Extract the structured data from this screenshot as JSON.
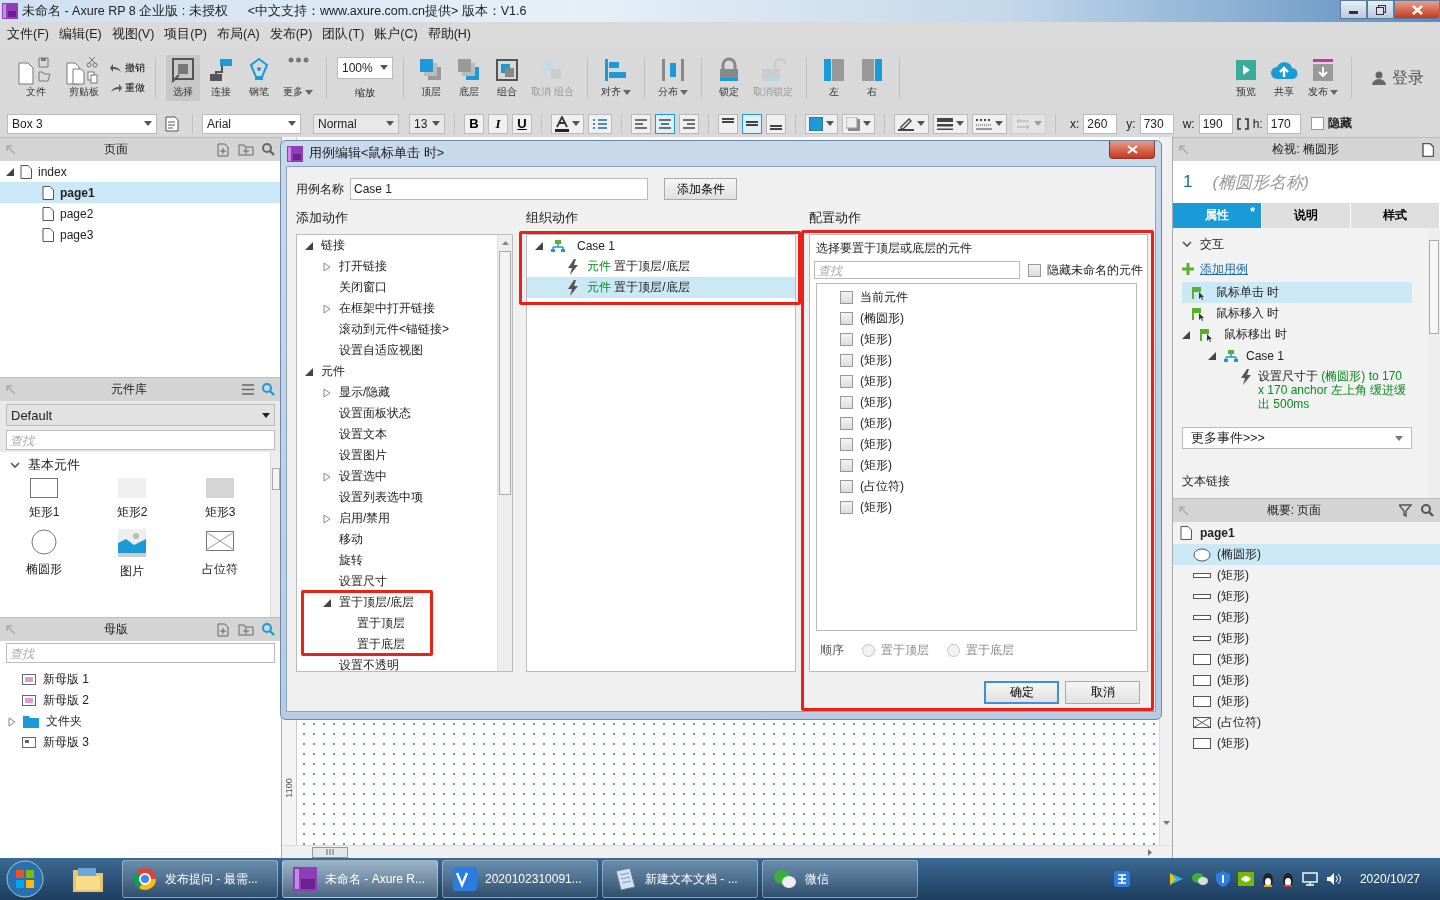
{
  "window": {
    "title": "未命名 - Axure RP 8 企业版 : 未授权",
    "subtitle": "<中文支持：www.axure.com.cn提供> 版本：V1.6"
  },
  "menu": [
    "文件(F)",
    "编辑(E)",
    "视图(V)",
    "项目(P)",
    "布局(A)",
    "发布(P)",
    "团队(T)",
    "账户(C)",
    "帮助(H)"
  ],
  "toolbar": {
    "groups": [
      [
        {
          "kind": "button",
          "label": "文件"
        },
        {
          "kind": "button",
          "label": "剪贴板"
        },
        {
          "kind": "history",
          "entries": [
            {
              "label": "撤销"
            },
            {
              "label": "重做"
            }
          ]
        }
      ],
      [
        {
          "kind": "button",
          "label": "选择",
          "selected": true
        },
        {
          "kind": "button",
          "label": "连接",
          "selected": false
        },
        {
          "kind": "button",
          "label": "钢笔",
          "selected": false
        },
        {
          "kind": "button",
          "label": "更多",
          "selected": false,
          "dropdown": true
        }
      ],
      [
        {
          "kind": "zoom",
          "value": "100%",
          "label": "缩放"
        }
      ],
      [
        {
          "kind": "button",
          "label": "顶层",
          "disabled": false
        },
        {
          "kind": "button",
          "label": "底层",
          "disabled": false
        },
        {
          "kind": "button",
          "label": "组合",
          "disabled": false
        },
        {
          "kind": "button",
          "label": "取消 组合",
          "disabled": true
        }
      ],
      [
        {
          "kind": "button",
          "label": "对齐",
          "dropdown": true
        }
      ],
      [
        {
          "kind": "button",
          "label": "分布",
          "dropdown": true
        }
      ],
      [
        {
          "kind": "button",
          "label": "锁定",
          "disabled": false
        },
        {
          "kind": "button",
          "label": "取消锁定",
          "disabled": true
        }
      ],
      [
        {
          "kind": "button",
          "label": "左"
        },
        {
          "kind": "button",
          "label": "右"
        }
      ],
      [
        {
          "kind": "button",
          "label": "预览"
        },
        {
          "kind": "button",
          "label": "共享"
        },
        {
          "kind": "button",
          "label": "发布",
          "dropdown": true
        }
      ],
      [
        {
          "kind": "account",
          "label": "登录"
        }
      ]
    ]
  },
  "format": {
    "widget_name": "Box 3",
    "font": "Arial",
    "weight": "Normal",
    "size": "13",
    "styles": [
      "B",
      "I",
      "U"
    ],
    "text_align": [
      {
        "selected": false
      },
      {
        "selected": true
      },
      {
        "selected": false
      }
    ],
    "vertical_align": [
      {
        "selected": false
      },
      {
        "selected": true
      },
      {
        "selected": false
      }
    ],
    "arrow_style": {
      "disabled": true
    },
    "position": [
      {
        "label": "x:",
        "value": "260"
      },
      {
        "label": "y:",
        "value": "730"
      },
      {
        "label": "w:",
        "value": "190"
      },
      {
        "label": "h:",
        "value": "170"
      }
    ],
    "hidden": {
      "label": "隐藏",
      "checked": false
    }
  },
  "pages": {
    "title": "页面",
    "tree": [
      {
        "label": "index",
        "expanded": true,
        "selected": false,
        "children": [
          {
            "label": "page1",
            "selected": true
          },
          {
            "label": "page2",
            "selected": false
          },
          {
            "label": "page3",
            "selected": false
          }
        ]
      }
    ]
  },
  "library": {
    "title": "元件库",
    "library": "Default",
    "search": {
      "placeholder": "查找"
    },
    "section": {
      "label": "基本元件",
      "expanded": true
    },
    "widgets": [
      {
        "label": "矩形1"
      },
      {
        "label": "矩形2"
      },
      {
        "label": "矩形3"
      },
      {
        "label": "椭圆形"
      },
      {
        "label": "图片"
      },
      {
        "label": "占位符"
      }
    ]
  },
  "masters": {
    "title": "母版",
    "search": {
      "placeholder": "查找"
    },
    "items": [
      {
        "label": "新母版 1",
        "kind": "master"
      },
      {
        "label": "新母版 2",
        "kind": "master"
      },
      {
        "label": "文件夹",
        "kind": "folder",
        "expanded": false
      },
      {
        "label": "新母版 3",
        "kind": "layout"
      }
    ]
  },
  "canvas": {
    "ruler_mark": "1100"
  },
  "dialog": {
    "title": "用例编辑<鼠标单击 时>",
    "case_name": {
      "label": "用例名称",
      "value": "Case 1"
    },
    "add_condition": "添加条件",
    "add_actions": {
      "label": "添加动作",
      "tree": [
        {
          "label": "链接",
          "expanded": true,
          "children": [
            {
              "label": "打开链接",
              "expanded": false
            },
            {
              "label": "关闭窗口"
            },
            {
              "label": "在框架中打开链接",
              "expanded": false
            },
            {
              "label": "滚动到元件<锚链接>"
            },
            {
              "label": "设置自适应视图"
            }
          ]
        },
        {
          "label": "元件",
          "expanded": true,
          "children": [
            {
              "label": "显示/隐藏",
              "expanded": false
            },
            {
              "label": "设置面板状态"
            },
            {
              "label": "设置文本"
            },
            {
              "label": "设置图片"
            },
            {
              "label": "设置选中",
              "expanded": false
            },
            {
              "label": "设置列表选中项"
            },
            {
              "label": "启用/禁用",
              "expanded": false
            },
            {
              "label": "移动"
            },
            {
              "label": "旋转"
            },
            {
              "label": "设置尺寸"
            },
            {
              "label": "置于顶层/底层",
              "expanded": true,
              "children": [
                {
                  "label": "置于顶层"
                },
                {
                  "label": "置于底层"
                }
              ]
            },
            {
              "label": "设置不透明"
            }
          ]
        }
      ]
    },
    "organize": {
      "label": "组织动作",
      "case": {
        "label": "Case 1",
        "expanded": true,
        "actions": [
          {
            "target": "元件",
            "action": "置于顶层/底层",
            "selected": false
          },
          {
            "target": "元件",
            "action": "置于顶层/底层",
            "selected": true
          }
        ]
      }
    },
    "configure": {
      "label": "配置动作",
      "heading": "选择要置于顶层或底层的元件",
      "search": {
        "placeholder": "查找"
      },
      "hide_unnamed": {
        "label": "隐藏未命名的元件",
        "checked": false
      },
      "widgets": [
        {
          "label": "当前元件",
          "checked": false
        },
        {
          "label": "(椭圆形)",
          "checked": false
        },
        {
          "label": "(矩形)",
          "checked": false
        },
        {
          "label": "(矩形)",
          "checked": false
        },
        {
          "label": "(矩形)",
          "checked": false
        },
        {
          "label": "(矩形)",
          "checked": false
        },
        {
          "label": "(矩形)",
          "checked": false
        },
        {
          "label": "(矩形)",
          "checked": false
        },
        {
          "label": "(矩形)",
          "checked": false
        },
        {
          "label": "(占位符)",
          "checked": false
        },
        {
          "label": "(矩形)",
          "checked": false
        }
      ],
      "order": {
        "label": "顺序",
        "options": [
          {
            "label": "置于顶层",
            "selected": false,
            "disabled": true
          },
          {
            "label": "置于底层",
            "selected": false,
            "disabled": true
          }
        ]
      }
    },
    "buttons": [
      {
        "label": "确定",
        "kind": "primary"
      },
      {
        "label": "取消",
        "kind": "normal"
      }
    ]
  },
  "inspector": {
    "title": "检视: 椭圆形",
    "index": "1",
    "name": {
      "placeholder": "(椭圆形名称)"
    },
    "tabs": [
      {
        "label": "属性",
        "selected": true,
        "badge": "*"
      },
      {
        "label": "说明",
        "selected": false
      },
      {
        "label": "样式",
        "selected": false
      }
    ],
    "interactions": {
      "label": "交互",
      "expanded": true,
      "add_case": "添加用例",
      "events": [
        {
          "label": "鼠标单击 时",
          "selected": true
        },
        {
          "label": "鼠标移入 时",
          "selected": false
        },
        {
          "label": "鼠标移出 时",
          "selected": false,
          "expanded": true,
          "cases": [
            {
              "label": "Case 1",
              "expanded": true,
              "actions": [
                {
                  "verb": "设置尺寸于",
                  "detail": "(椭圆形) to 170 x 170 anchor 左上角 缓进缓出 500ms"
                }
              ]
            }
          ]
        }
      ],
      "more_events": "更多事件>>>"
    },
    "next_section": "文本链接"
  },
  "outline": {
    "title": "概要: 页面",
    "page": "page1",
    "items": [
      {
        "label": "(椭圆形)",
        "kind": "ellipse",
        "selected": true
      },
      {
        "label": "(矩形)",
        "kind": "line",
        "selected": false
      },
      {
        "label": "(矩形)",
        "kind": "line",
        "selected": false
      },
      {
        "label": "(矩形)",
        "kind": "line",
        "selected": false
      },
      {
        "label": "(矩形)",
        "kind": "line",
        "selected": false
      },
      {
        "label": "(矩形)",
        "kind": "rect",
        "selected": false
      },
      {
        "label": "(矩形)",
        "kind": "rect",
        "selected": false
      },
      {
        "label": "(矩形)",
        "kind": "rect",
        "selected": false
      },
      {
        "label": "(占位符)",
        "kind": "placeholder",
        "selected": false
      },
      {
        "label": "(矩形)",
        "kind": "rect",
        "selected": false
      }
    ]
  },
  "taskbar": {
    "tasks": [
      {
        "label": "发布提问 - 最需...",
        "selected": false
      },
      {
        "label": "未命名 - Axure R...",
        "selected": true
      },
      {
        "label": "2020102310091...",
        "selected": false
      },
      {
        "label": "新建文本文档 - ...",
        "selected": false
      },
      {
        "label": "微信",
        "selected": false
      }
    ],
    "date": "2020/10/27"
  }
}
